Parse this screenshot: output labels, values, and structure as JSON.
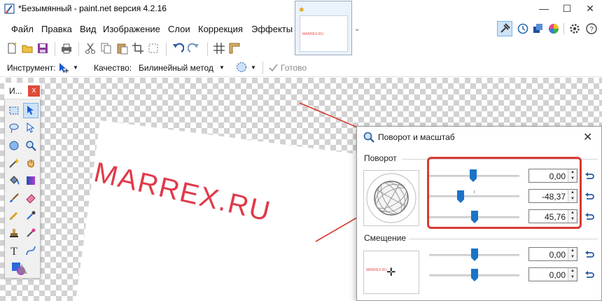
{
  "window": {
    "title": "*Безымянный - paint.net версия 4.2.16",
    "minimize_glyph": "—",
    "maximize_glyph": "☐",
    "close_glyph": "✕"
  },
  "menu": [
    {
      "label": "Файл"
    },
    {
      "label": "Правка"
    },
    {
      "label": "Вид"
    },
    {
      "label": "Изображение"
    },
    {
      "label": "Слои"
    },
    {
      "label": "Коррекция"
    },
    {
      "label": "Эффекты"
    }
  ],
  "thumbnail": {
    "text": "MARREX.RU"
  },
  "options": {
    "tool_label": "Инструмент:",
    "quality_label": "Качество:",
    "quality_value": "Билинейный метод",
    "done_label": "Готово"
  },
  "tools_panel": {
    "title": "И...",
    "close_glyph": "x"
  },
  "canvas": {
    "watermark": "MARREX.RU"
  },
  "dialog": {
    "title": "Поворот и масштаб",
    "close_glyph": "✕",
    "rotation": {
      "label": "Поворот",
      "values": [
        "0,00",
        "-48,37",
        "45,76"
      ]
    },
    "offset": {
      "label": "Смещение",
      "preview_text": "MARREX.RU",
      "values": [
        "0,00",
        "0,00"
      ]
    }
  },
  "colors": {
    "accent_red": "#d83a32",
    "thumb_blue": "#1a73c8",
    "watermark": "#e03a4a"
  }
}
